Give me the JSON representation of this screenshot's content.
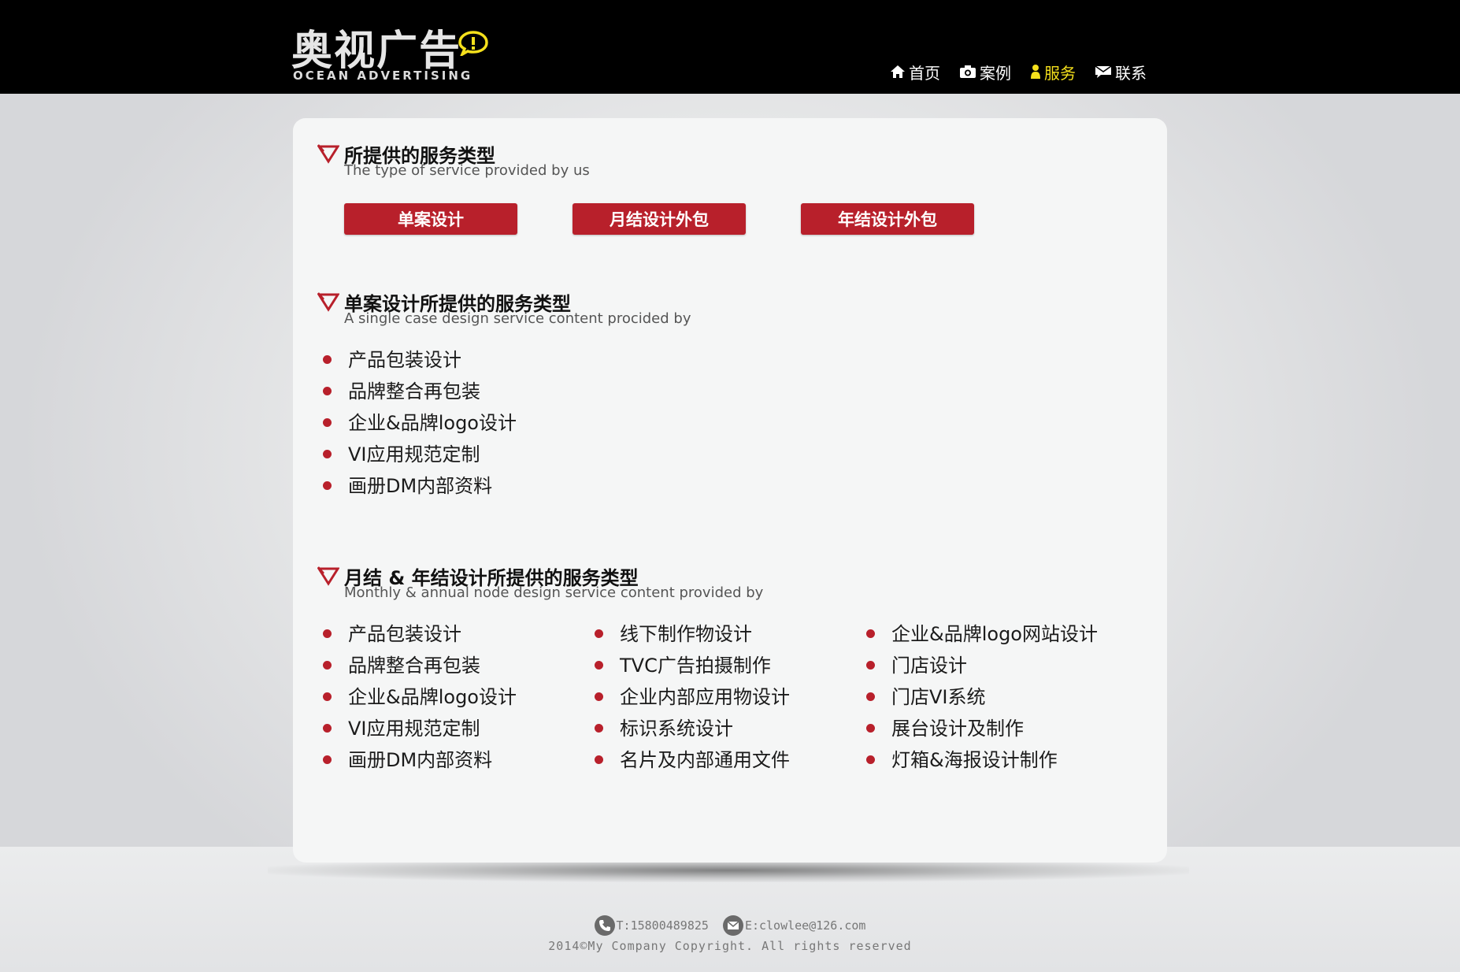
{
  "brand": {
    "name_cn": "奥视广告",
    "name_en": "OCEAN ADVERTISING"
  },
  "nav": [
    {
      "label": "首页",
      "icon": "home-icon"
    },
    {
      "label": "案例",
      "icon": "camera-icon"
    },
    {
      "label": "服务",
      "icon": "user-icon",
      "active": true
    },
    {
      "label": "联系",
      "icon": "mail-icon"
    }
  ],
  "colors": {
    "accent": "#b8202b",
    "nav_active": "#f5e01c"
  },
  "section1": {
    "title": "所提供的服务类型",
    "subtitle": "The type of service provided by us",
    "buttons": [
      "单案设计",
      "月结设计外包",
      "年结设计外包"
    ]
  },
  "section2": {
    "title": "单案设计所提供的服务类型",
    "subtitle": "A single case design service content procided by",
    "items": [
      "产品包装设计",
      "品牌整合再包装",
      "企业&品牌logo设计",
      "VI应用规范定制",
      "画册DM内部资料"
    ]
  },
  "section3": {
    "title": "月结 & 年结设计所提供的服务类型",
    "subtitle": "Monthly & annual node design service content provided by",
    "columns": [
      [
        "产品包装设计",
        "品牌整合再包装",
        "企业&品牌logo设计",
        "VI应用规范定制",
        "画册DM内部资料"
      ],
      [
        "线下制作物设计",
        "TVC广告拍摄制作",
        "企业内部应用物设计",
        "标识系统设计",
        "名片及内部通用文件"
      ],
      [
        "企业&品牌logo网站设计",
        "门店设计",
        "门店VI系统",
        "展台设计及制作",
        "灯箱&海报设计制作"
      ]
    ]
  },
  "footer": {
    "phone": "T:15800489825",
    "email": "E:clowlee@126.com",
    "copyright": "2014©My Company Copyright. All rights reserved"
  }
}
